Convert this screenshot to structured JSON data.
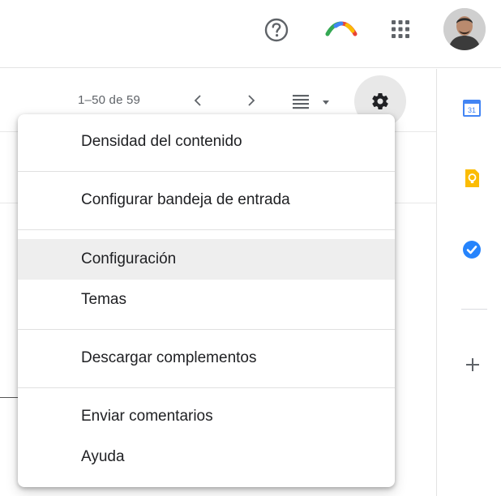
{
  "header": {
    "help_icon": "help-circle-icon",
    "apps_logo_icon": "workspace-logo-icon",
    "apps_grid_icon": "apps-grid-icon",
    "avatar_icon": "user-avatar"
  },
  "toolbar": {
    "page_count": "1–50 de 59",
    "prev_icon": "chevron-left-icon",
    "next_icon": "chevron-right-icon",
    "view_icon": "list-view-icon",
    "settings_icon": "gear-icon"
  },
  "side_panel": {
    "calendar_badge": "31",
    "icons": [
      "calendar-icon",
      "keep-icon",
      "tasks-icon",
      "add-icon"
    ]
  },
  "settings_menu": {
    "items": [
      {
        "label": "Densidad del contenido"
      },
      {
        "label": "Configurar bandeja de entrada"
      },
      {
        "label": "Configuración"
      },
      {
        "label": "Temas"
      },
      {
        "label": "Descargar complementos"
      },
      {
        "label": "Enviar comentarios"
      },
      {
        "label": "Ayuda"
      }
    ]
  },
  "colors": {
    "menu_hover": "#eeeeee",
    "settings_button_bg": "#e8e8e8",
    "calendar_blue": "#4285f4",
    "keep_yellow": "#fbbc04",
    "tasks_blue": "#2684fc"
  }
}
